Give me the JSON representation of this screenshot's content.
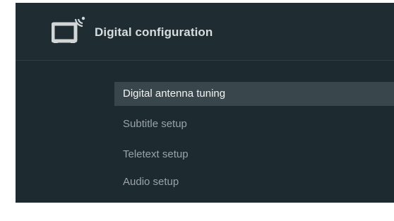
{
  "header": {
    "title": "Digital configuration",
    "icon": "tv-satellite-icon"
  },
  "menu": {
    "items": [
      {
        "label": "Digital antenna tuning",
        "selected": true
      },
      {
        "label": "Subtitle setup",
        "selected": false
      },
      {
        "label": "Teletext setup",
        "selected": false
      },
      {
        "label": "Audio setup",
        "selected": false
      }
    ]
  },
  "colors": {
    "background": "#1d2b31",
    "highlight": "#39474c",
    "title_text": "#d7dcdd",
    "item_text": "#9aa3a6",
    "selected_text": "#f2f4f4",
    "icon": "#d2d6d7"
  }
}
